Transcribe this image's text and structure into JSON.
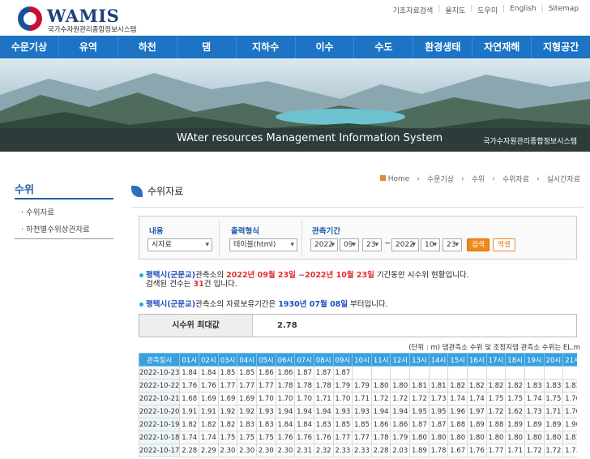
{
  "header": {
    "logo_name": "WAMIS",
    "logo_sub": "국가수자원관리종합정보시스템",
    "util_links": [
      "기초자료검색",
      "율지도",
      "도우미",
      "English",
      "Sitemap"
    ]
  },
  "nav": [
    "수문기상",
    "유역",
    "하천",
    "댐",
    "지하수",
    "이수",
    "수도",
    "환경생태",
    "자연재해",
    "지형공간"
  ],
  "banner": {
    "title": "WAter resources Management Information System",
    "right_text": "국가수자원관리종합정보시스템"
  },
  "sidebar": {
    "title": "수위",
    "items": [
      "수위자료",
      "하천별수위상관자료"
    ]
  },
  "breadcrumb": [
    "Home",
    "수문기상",
    "수위",
    "수위자료",
    "실시간자료"
  ],
  "page_title": "수위자료",
  "search": {
    "label_content": "내용",
    "label_format": "출력형식",
    "label_period": "관측기간",
    "content_value": "시자료",
    "format_value": "테이블(html)",
    "start_year": "2022",
    "start_month": "09",
    "start_day": "23",
    "tilde": "~",
    "end_year": "2022",
    "end_month": "10",
    "end_day": "23",
    "search_button": "검색",
    "excel_button": "엑셀"
  },
  "info1": {
    "station": "평택시(군문교)",
    "t1": "관측소의 ",
    "period": "2022년 09월 23일 ~2022년 10월 23일",
    "t2": " 기간동안 시수위 현황입니다.",
    "line2a": "검색된 건수는 ",
    "count": "31",
    "line2b": "건 입니다."
  },
  "info2": {
    "station": "평택시(군문교)",
    "t1": "관측소의 자료보유기간은 ",
    "start": "1930년 07월 08일",
    "t2": " 부터입니다."
  },
  "max": {
    "label": "시수위 최대값",
    "value": "2.78"
  },
  "unit_note": "(단위 : m)   댐관측소 수위 및 조정지댐 관측소 수위는 EL.m",
  "table": {
    "headers": [
      "관측일시",
      "01시",
      "02시",
      "03시",
      "04시",
      "05시",
      "06시",
      "07시",
      "08시",
      "09시",
      "10시",
      "11시",
      "12시",
      "13시",
      "14시",
      "15시",
      "16시",
      "17시",
      "18시",
      "19시",
      "20시",
      "21시"
    ],
    "rows": [
      [
        "2022-10-23",
        "1.84",
        "1.84",
        "1.85",
        "1.85",
        "1.86",
        "1.86",
        "1.87",
        "1.87",
        "1.87",
        "",
        "",
        "",
        "",
        "",
        "",
        "",
        "",
        "",
        "",
        "",
        ""
      ],
      [
        "2022-10-22",
        "1.76",
        "1.76",
        "1.77",
        "1.77",
        "1.77",
        "1.78",
        "1.78",
        "1.78",
        "1.79",
        "1.79",
        "1.80",
        "1.80",
        "1.81",
        "1.81",
        "1.82",
        "1.82",
        "1.82",
        "1.82",
        "1.83",
        "1.83",
        "1.83"
      ],
      [
        "2022-10-21",
        "1.68",
        "1.69",
        "1.69",
        "1.69",
        "1.70",
        "1.70",
        "1.70",
        "1.71",
        "1.70",
        "1.71",
        "1.72",
        "1.72",
        "1.72",
        "1.73",
        "1.74",
        "1.74",
        "1.75",
        "1.75",
        "1.74",
        "1.75",
        "1.76"
      ],
      [
        "2022-10-20",
        "1.91",
        "1.91",
        "1.92",
        "1.92",
        "1.93",
        "1.94",
        "1.94",
        "1.94",
        "1.93",
        "1.93",
        "1.94",
        "1.94",
        "1.95",
        "1.95",
        "1.96",
        "1.97",
        "1.72",
        "1.62",
        "1.73",
        "1.71",
        "1.70"
      ],
      [
        "2022-10-19",
        "1.82",
        "1.82",
        "1.82",
        "1.83",
        "1.83",
        "1.84",
        "1.84",
        "1.83",
        "1.85",
        "1.85",
        "1.86",
        "1.86",
        "1.87",
        "1.87",
        "1.88",
        "1.89",
        "1.88",
        "1.89",
        "1.89",
        "1.89",
        "1.90"
      ],
      [
        "2022-10-18",
        "1.74",
        "1.74",
        "1.75",
        "1.75",
        "1.75",
        "1.76",
        "1.76",
        "1.76",
        "1.77",
        "1.77",
        "1.78",
        "1.79",
        "1.80",
        "1.80",
        "1.80",
        "1.80",
        "1.80",
        "1.80",
        "1.80",
        "1.80",
        "1.81"
      ],
      [
        "2022-10-17",
        "2.28",
        "2.29",
        "2.30",
        "2.30",
        "2.30",
        "2.30",
        "2.31",
        "2.32",
        "2.33",
        "2.33",
        "2.28",
        "2.03",
        "1.89",
        "1.78",
        "1.67",
        "1.76",
        "1.77",
        "1.71",
        "1.72",
        "1.72",
        "1.73"
      ]
    ]
  }
}
